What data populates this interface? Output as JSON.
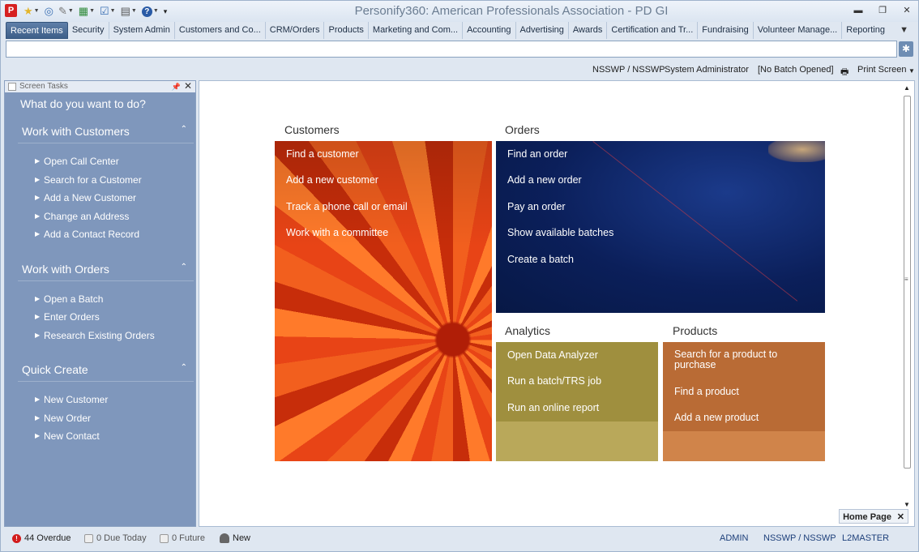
{
  "window": {
    "title": "Personify360: American Professionals Association - PD GI",
    "logo_letter": "P"
  },
  "qat": [
    {
      "icon": "star-icon",
      "glyph": "★"
    },
    {
      "icon": "globe-icon",
      "glyph": "◎"
    },
    {
      "icon": "tools-icon",
      "glyph": "✎"
    },
    {
      "icon": "chart-icon",
      "glyph": "▦"
    },
    {
      "icon": "checklist-icon",
      "glyph": "☑"
    },
    {
      "icon": "document-icon",
      "glyph": "▤"
    },
    {
      "icon": "help-icon",
      "glyph": "?"
    },
    {
      "icon": "customize-icon",
      "glyph": "▾"
    }
  ],
  "tabs": [
    "Recent Items",
    "Security",
    "System Admin",
    "Customers and Co...",
    "CRM/Orders",
    "Products",
    "Marketing and Com...",
    "Accounting",
    "Advertising",
    "Awards",
    "Certification and Tr...",
    "Fundraising",
    "Volunteer Manage...",
    "Reporting"
  ],
  "userbar": {
    "org": "NSSWP / NSSWP",
    "role": "System Administrator",
    "batch": "[No Batch Opened]",
    "print": "Print Screen"
  },
  "leftpane": {
    "header": "Screen Tasks",
    "what": "What do you want to do?",
    "groups": [
      {
        "title": "Work with Customers",
        "items": [
          "Open Call Center",
          "Search for a Customer",
          "Add a New Customer",
          "Change an Address",
          "Add a Contact Record"
        ]
      },
      {
        "title": "Work with Orders",
        "items": [
          "Open a Batch",
          "Enter Orders",
          "Research Existing Orders"
        ]
      },
      {
        "title": "Quick Create",
        "items": [
          "New Customer",
          "New Order",
          "New Contact"
        ]
      }
    ]
  },
  "main": {
    "customers": {
      "title": "Customers",
      "links": [
        "Find a customer",
        "Add a new customer",
        "Track a phone call or email",
        "Work with a committee"
      ]
    },
    "orders": {
      "title": "Orders",
      "links": [
        "Find an order",
        "Add a new order",
        "Pay an order",
        "Show available batches",
        "Create a batch"
      ]
    },
    "analytics": {
      "title": "Analytics",
      "links": [
        "Open Data Analyzer",
        "Run a batch/TRS job",
        "Run an online report"
      ]
    },
    "products": {
      "title": "Products",
      "links": [
        "Search for a product to purchase",
        "Find a product",
        "Add a new product"
      ]
    },
    "homepage_tab": "Home Page"
  },
  "status": {
    "overdue": "44 Overdue",
    "due_today": "0 Due Today",
    "future": "0 Future",
    "new": "New",
    "user": "ADMIN",
    "org": "NSSWP / NSSWP",
    "db": "L2MASTER"
  }
}
